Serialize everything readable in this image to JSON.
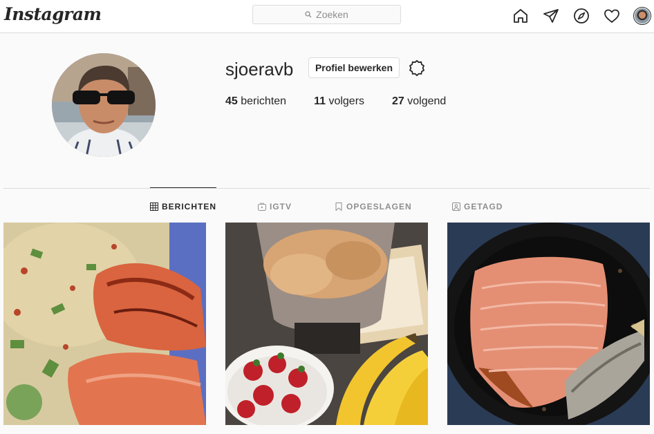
{
  "app": {
    "logo_text": "Instagram"
  },
  "search": {
    "placeholder": "Zoeken"
  },
  "nav": {
    "icons": [
      "home-icon",
      "direct-icon",
      "explore-icon",
      "activity-heart-icon",
      "profile-avatar"
    ]
  },
  "profile": {
    "username": "sjoeravb",
    "edit_label": "Profiel bewerken",
    "stats": [
      {
        "count": "45",
        "label": "berichten"
      },
      {
        "count": "11",
        "label": "volgers"
      },
      {
        "count": "27",
        "label": "volgend"
      }
    ]
  },
  "tabs": [
    {
      "label": "BERICHTEN",
      "icon": "grid-icon",
      "active": true
    },
    {
      "label": "IGTV",
      "icon": "igtv-icon",
      "active": false
    },
    {
      "label": "OPGESLAGEN",
      "icon": "bookmark-icon",
      "active": false
    },
    {
      "label": "GETAGD",
      "icon": "tagged-icon",
      "active": false
    }
  ],
  "posts": [
    {
      "subject": "salmon with couscous"
    },
    {
      "subject": "ice cream in blender with strawberries and bananas"
    },
    {
      "subject": "salmon fillet in frying pan"
    }
  ],
  "colors": {
    "border": "#dbdbdb",
    "text": "#262626",
    "muted": "#8e8e8e",
    "background": "#fafafa"
  }
}
